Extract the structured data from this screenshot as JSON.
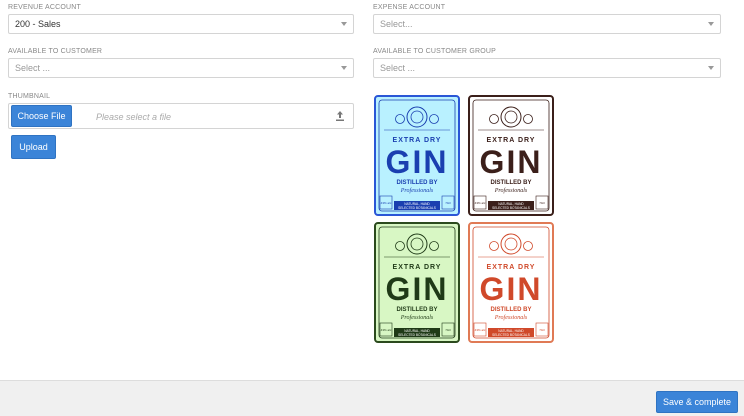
{
  "fields": {
    "revenue_account": {
      "label": "REVENUE ACCOUNT",
      "value": "200 - Sales"
    },
    "expense_account": {
      "label": "EXPENSE ACCOUNT",
      "placeholder": "Select..."
    },
    "available_to_customer": {
      "label": "AVAILABLE TO CUSTOMER",
      "placeholder": "Select ..."
    },
    "available_to_customer_group": {
      "label": "AVAILABLE TO CUSTOMER GROUP",
      "placeholder": "Select ..."
    }
  },
  "thumbnail": {
    "label": "THUMBNAIL",
    "choose_file_label": "Choose File",
    "file_placeholder": "Please select a file",
    "upload_label": "Upload"
  },
  "gin_labels": [
    {
      "variant": "blue",
      "top": "EXTRA DRY",
      "main": "GIN",
      "sub": "DISTILLED BY",
      "script": "Professionals",
      "bottom1": "NATURAL, HAND",
      "bottom2": "SELECTED BOTANICALS",
      "left_badge": "43% alc",
      "right_badge": "70cl",
      "colors": {
        "bg": "#b9f1ff",
        "ink": "#1a3fb0",
        "border": "#2a56d6"
      }
    },
    {
      "variant": "brown",
      "top": "EXTRA DRY",
      "main": "GIN",
      "sub": "DISTILLED BY",
      "script": "Professionals",
      "bottom1": "NATURAL, HAND",
      "bottom2": "SELECTED BOTANICALS",
      "left_badge": "43% alc",
      "right_badge": "70cl",
      "colors": {
        "bg": "#ffffff",
        "ink": "#3b1f1a",
        "border": "#3b1f1a"
      }
    },
    {
      "variant": "green",
      "top": "EXTRA DRY",
      "main": "GIN",
      "sub": "DISTILLED BY",
      "script": "Professionals",
      "bottom1": "NATURAL, HAND",
      "bottom2": "SELECTED BOTANICALS",
      "left_badge": "43% alc",
      "right_badge": "70cl",
      "colors": {
        "bg": "#d8f7c4",
        "ink": "#1f3a17",
        "border": "#2b4a1d"
      }
    },
    {
      "variant": "orange",
      "top": "EXTRA DRY",
      "main": "GIN",
      "sub": "DISTILLED BY",
      "script": "Professionals",
      "bottom1": "NATURAL, HAND",
      "bottom2": "SELECTED BOTANICALS",
      "left_badge": "43% alc",
      "right_badge": "70cl",
      "colors": {
        "bg": "#ffffff",
        "ink": "#d0492a",
        "border": "#e07a55"
      }
    }
  ],
  "footer": {
    "save_complete_label": "Save & complete"
  },
  "colors": {
    "primary": "#3b84d8"
  }
}
